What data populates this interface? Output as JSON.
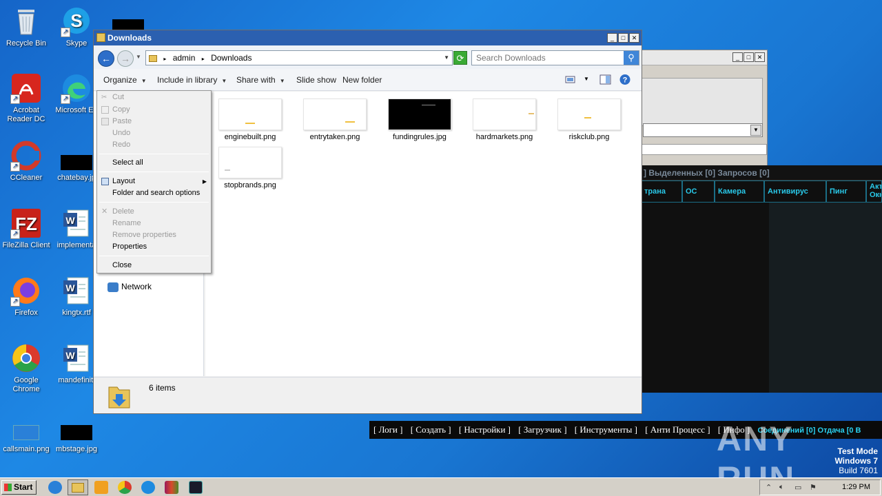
{
  "desktop": {
    "icons": [
      {
        "label": "Recycle Bin"
      },
      {
        "label": "Skype"
      },
      {
        "label": "Acrobat Reader DC"
      },
      {
        "label": "Microsoft Ed"
      },
      {
        "label": "CCleaner"
      },
      {
        "label": "chatebay.jp"
      },
      {
        "label": "FileZilla Client"
      },
      {
        "label": "implementa"
      },
      {
        "label": "Firefox"
      },
      {
        "label": "kingtx.rtf"
      },
      {
        "label": "Google Chrome"
      },
      {
        "label": "mandefiniti"
      },
      {
        "label": "callsmain.png"
      },
      {
        "label": "mbstage.jpg"
      }
    ]
  },
  "explorer": {
    "title": "Downloads",
    "breadcrumb": [
      "admin",
      "Downloads"
    ],
    "search_placeholder": "Search Downloads",
    "toolbar": {
      "organize": "Organize",
      "include_in_library": "Include in library",
      "share_with": "Share with",
      "slide_show": "Slide show",
      "new_folder": "New folder"
    },
    "nav": {
      "network": "Network"
    },
    "files": [
      {
        "name": "enginebuilt.png"
      },
      {
        "name": "entrytaken.png"
      },
      {
        "name": "fundingrules.jpg"
      },
      {
        "name": "hardmarkets.png"
      },
      {
        "name": "riskclub.png"
      },
      {
        "name": "stopbrands.png"
      }
    ],
    "item_count": "6 items"
  },
  "context_menu": {
    "items": [
      {
        "label": "Cut",
        "enabled": false
      },
      {
        "label": "Copy",
        "enabled": false
      },
      {
        "label": "Paste",
        "enabled": false
      },
      {
        "label": "Undo",
        "enabled": false
      },
      {
        "label": "Redo",
        "enabled": false
      },
      {
        "label": "Select all",
        "enabled": true
      },
      {
        "label": "Layout",
        "enabled": true
      },
      {
        "label": "Folder and search options",
        "enabled": true
      },
      {
        "label": "Delete",
        "enabled": false
      },
      {
        "label": "Rename",
        "enabled": false
      },
      {
        "label": "Remove properties",
        "enabled": false
      },
      {
        "label": "Properties",
        "enabled": true
      },
      {
        "label": "Close",
        "enabled": true
      }
    ]
  },
  "console": {
    "status": "]  Выделенных [0]  Запросов [0]",
    "columns": [
      "трана",
      "ОС",
      "Камера",
      "Антивирус",
      "Пинг",
      "Акт Окн"
    ],
    "menu": [
      "[ Логи ]",
      "[ Создать ]",
      "[ Настройки ]",
      "[ Загрузчик ]",
      "[ Инструменты ]",
      "[ Анти Процесс ]",
      "[ Инфо ]"
    ],
    "status_cyan": "Соединений [0]  Отдача [0 В"
  },
  "taskbar": {
    "start": "Start",
    "clock": "1:29 PM"
  },
  "watermark": {
    "line1": "Test Mode",
    "line2": "Windows 7",
    "line3": "Build 7601",
    "brand": "ANY RUN"
  },
  "colors": {
    "desktop": "#1976d2",
    "titlebar": "#2b60b0",
    "console_accent": "#29c8e8"
  }
}
